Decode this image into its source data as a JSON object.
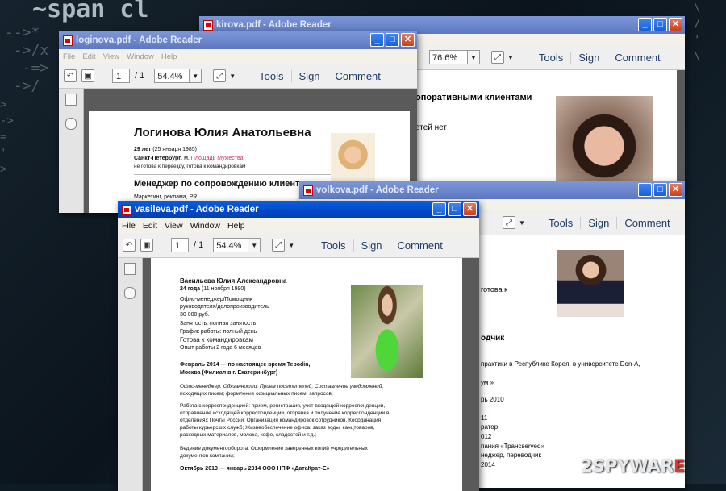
{
  "background_code": {
    "line1": "~span cl",
    "lines2": "-->*\n ->/x\n  -=>\n ->/",
    "lines3": ">\n->\n=\n'\n>",
    "lines4": "\\\n/\n'\n\\",
    "lines5": ""
  },
  "windows": {
    "kirova": {
      "title": "kirova.pdf - Adobe Reader",
      "zoom": "76.6%",
      "tools": "Tools",
      "sign": "Sign",
      "comment": "Comment",
      "text1": "опоративными клиентами",
      "text2": "етей нет"
    },
    "loginova": {
      "title": "loginova.pdf - Adobe Reader",
      "menu": [
        "File",
        "Edit",
        "View",
        "Window",
        "Help"
      ],
      "page": "1",
      "pages": "/ 1",
      "zoom": "54.4%",
      "tools": "Tools",
      "sign": "Sign",
      "comment": "Comment",
      "name": "Логинова Юлия Анатольевна",
      "age": "29 лет",
      "birth": "(25 января 1985)",
      "city": "Санкт-Петербург",
      "metro_sep": ", м.",
      "metro": "Площадь Мужества",
      "relocation": "не готова к переезду, готова к командировкам",
      "position": "Менеджер по сопровождению клиентов",
      "field": "Маркетинг, реклама, PR"
    },
    "volkova": {
      "title": "volkova.pdf - Adobe Reader",
      "tools": "Tools",
      "sign": "Sign",
      "comment": "Comment",
      "lines": [
        "готова к",
        "одчик",
        "практики в Республике Корея, в университете Don-A,",
        "ум »",
        "рь 2010",
        "11",
        "ратор",
        "012",
        "пания «Трансserved»",
        "неджер, переводчик",
        "2014"
      ]
    },
    "vasileva": {
      "title": "vasileva.pdf - Adobe Reader",
      "menu": [
        "File",
        "Edit",
        "View",
        "Window",
        "Help"
      ],
      "page": "1",
      "pages": "/ 1",
      "zoom": "54.4%",
      "tools": "Tools",
      "sign": "Sign",
      "comment": "Comment",
      "name": "Васильева Юлия Александровна",
      "age": "24 года",
      "birth": "(11 ноября 1990)",
      "position1": "Офис-менеджер/Помощник",
      "position2": "руководителя/делопроизводитель",
      "salary": "30 000 руб.",
      "employment": "Занятость: полная занятость",
      "schedule": "График работы: полный день",
      "trips": "Готова к командировкам",
      "experience": "Опыт работы 2 года 6 месяцев",
      "job1_period": "Февраль 2014 — по настоящее время  Tebodin,",
      "job1_place": "Москва (Филиал в г. Екатеринбург)",
      "duties1": "Офис-менеджер.  Обязанности:  Прием посетителей;  Составление уведомлений,",
      "duties2": "исходящих писем;  формление официальных писем, запросов;",
      "corr1": "Работа с корреспонденцией: прием, регистрация, учет входящей корреспонденции,",
      "corr2": "отправление исходящей корреспонденции, отправка и получение корреспонденции в",
      "corr3": "отделениях Почты России; Организация командировок сотрудников, Координация",
      "corr4": "работы курьерских служб; Жизнеобеспечение офиса: заказ воды, канцтоваров,",
      "corr5": "расходных материалов, молока, кофе, сладостей и т.д.;",
      "docs1": "Ведение документооборота. Оформление заверенных копий учредительных",
      "docs2": "документов компании;",
      "job2_period": "Октябрь 2013 — январь 2014  ООО НПФ «ДатаКрат-Е»"
    }
  },
  "watermark": {
    "part1": "2SPYWAR",
    "part2": "E"
  }
}
